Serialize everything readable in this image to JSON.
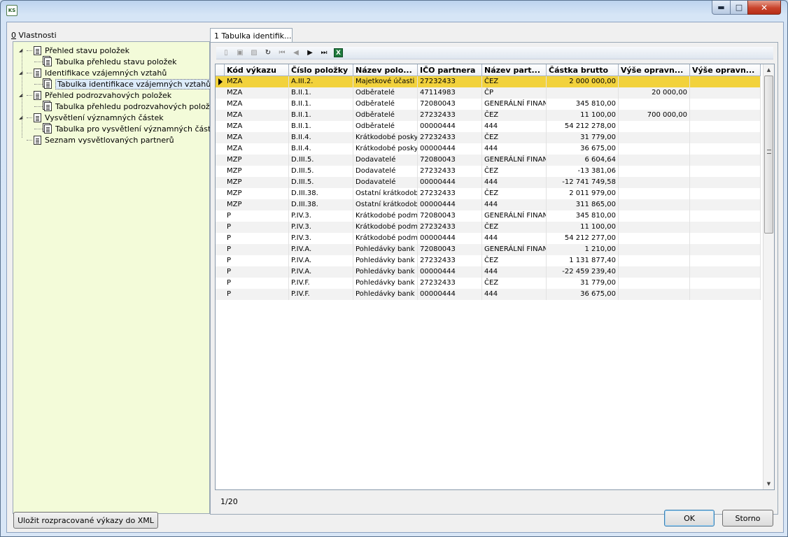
{
  "window": {
    "icon_text": "KS"
  },
  "left_panel": {
    "label_mnemonic": "0",
    "label_rest": " Vlastnosti"
  },
  "tree": [
    {
      "label": "Přehled stavu položek",
      "level": 0
    },
    {
      "label": "Tabulka přehledu stavu položek",
      "level": 1
    },
    {
      "label": "Identifikace vzájemných vztahů",
      "level": 0
    },
    {
      "label": "Tabulka identifikace vzájemných vztahů",
      "level": 1,
      "selected": true
    },
    {
      "label": "Přehled podrozvahových položek",
      "level": 0
    },
    {
      "label": "Tabulka přehledu podrozvahových položek",
      "level": 1
    },
    {
      "label": "Vysvětlení významných částek",
      "level": 0
    },
    {
      "label": "Tabulka pro vysvětlení významných částek",
      "level": 1
    },
    {
      "label": "Seznam vysvětlovaných partnerů",
      "level": 0
    }
  ],
  "tab": {
    "label": "1 Tabulka identifik..."
  },
  "toolbar": {
    "icons": [
      "new-icon",
      "open-icon",
      "delete-icon",
      "refresh-icon",
      "first-icon",
      "prev-icon",
      "next-icon",
      "last-icon",
      "excel-icon"
    ]
  },
  "grid": {
    "columns": [
      "Kód výkazu",
      "Číslo položky",
      "Název polo...",
      "IČO partnera",
      "Název part...",
      "Částka brutto",
      "Výše opravn...",
      "Výše opravn..."
    ],
    "rows": [
      [
        "MZA",
        "A.III.2.",
        "Majetkové účasti v",
        "27232433",
        "ČEZ",
        "2 000 000,00",
        "",
        ""
      ],
      [
        "MZA",
        "B.II.1.",
        "Odběratelé",
        "47114983",
        "ČP",
        "",
        "20 000,00",
        ""
      ],
      [
        "MZA",
        "B.II.1.",
        "Odběratelé",
        "72080043",
        "GENERÁLNÍ FINAN",
        "345 810,00",
        "",
        ""
      ],
      [
        "MZA",
        "B.II.1.",
        "Odběratelé",
        "27232433",
        "ČEZ",
        "11 100,00",
        "700 000,00",
        ""
      ],
      [
        "MZA",
        "B.II.1.",
        "Odběratelé",
        "00000444",
        "444",
        "54 212 278,00",
        "",
        ""
      ],
      [
        "MZA",
        "B.II.4.",
        "Krátkodobé poskyt",
        "27232433",
        "ČEZ",
        "31 779,00",
        "",
        ""
      ],
      [
        "MZA",
        "B.II.4.",
        "Krátkodobé poskyt",
        "00000444",
        "444",
        "36 675,00",
        "",
        ""
      ],
      [
        "MZP",
        "D.III.5.",
        "Dodavatelé",
        "72080043",
        "GENERÁLNÍ FINAN",
        "6 604,64",
        "",
        ""
      ],
      [
        "MZP",
        "D.III.5.",
        "Dodavatelé",
        "27232433",
        "ČEZ",
        "-13 381,06",
        "",
        ""
      ],
      [
        "MZP",
        "D.III.5.",
        "Dodavatelé",
        "00000444",
        "444",
        "-12 741 749,58",
        "",
        ""
      ],
      [
        "MZP",
        "D.III.38.",
        "Ostatní krátkodobé",
        "27232433",
        "ČEZ",
        "2 011 979,00",
        "",
        ""
      ],
      [
        "MZP",
        "D.III.38.",
        "Ostatní krátkodobé",
        "00000444",
        "444",
        "311 865,00",
        "",
        ""
      ],
      [
        "P",
        "P.IV.3.",
        "Krátkodobé podmír",
        "72080043",
        "GENERÁLNÍ FINAN",
        "345 810,00",
        "",
        ""
      ],
      [
        "P",
        "P.IV.3.",
        "Krátkodobé podmír",
        "27232433",
        "ČEZ",
        "11 100,00",
        "",
        ""
      ],
      [
        "P",
        "P.IV.3.",
        "Krátkodobé podmír",
        "00000444",
        "444",
        "54 212 277,00",
        "",
        ""
      ],
      [
        "P",
        "P.IV.A.",
        "Pohledávky bank z",
        "72080043",
        "GENERÁLNÍ FINAN",
        "1 210,00",
        "",
        ""
      ],
      [
        "P",
        "P.IV.A.",
        "Pohledávky bank z",
        "27232433",
        "ČEZ",
        "1 131 877,40",
        "",
        ""
      ],
      [
        "P",
        "P.IV.A.",
        "Pohledávky bank z",
        "00000444",
        "444",
        "-22 459 239,40",
        "",
        ""
      ],
      [
        "P",
        "P.IV.F.",
        "Pohledávky bank z",
        "27232433",
        "ČEZ",
        "31 779,00",
        "",
        ""
      ],
      [
        "P",
        "P.IV.F.",
        "Pohledávky bank z",
        "00000444",
        "444",
        "36 675,00",
        "",
        ""
      ]
    ],
    "selected_row": 0
  },
  "status": {
    "record": "1/20"
  },
  "buttons": {
    "save_xml": "Uložit rozpracované výkazy do XML",
    "ok": "OK",
    "cancel": "Storno"
  }
}
